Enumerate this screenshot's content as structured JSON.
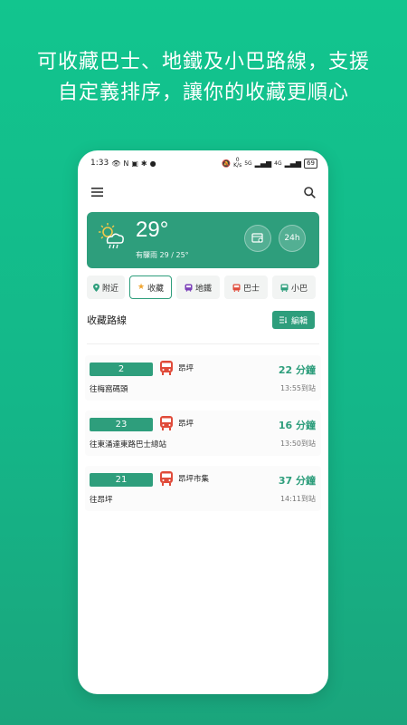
{
  "headline": {
    "line1": "可收藏巴士、地鐵及小巴路線，支援",
    "line2": "自定義排序，讓你的收藏更順心"
  },
  "status_bar": {
    "time": "1:33",
    "network_speed": "0\nK/s",
    "signal": "5G",
    "signal2": "4G",
    "battery": "69"
  },
  "weather": {
    "temperature": "29°",
    "description": "有驟雨 29 / 25°",
    "btn_24h": "24h"
  },
  "tabs": [
    {
      "label": "附近",
      "icon": "location-pin-icon"
    },
    {
      "label": "收藏",
      "icon": "star-icon"
    },
    {
      "label": "地鐵",
      "icon": "metro-icon"
    },
    {
      "label": "巴士",
      "icon": "bus-icon"
    },
    {
      "label": "小巴",
      "icon": "minibus-icon"
    }
  ],
  "favorites": {
    "title": "收藏路線",
    "edit_label": "編輯"
  },
  "routes": [
    {
      "number": "2",
      "stop": "昂坪",
      "destination": "往梅窩碼頭",
      "eta": "22 分鐘",
      "arrive": "13:55到站"
    },
    {
      "number": "23",
      "stop": "昂坪",
      "destination": "往東涌達東路巴士總站",
      "eta": "16 分鐘",
      "arrive": "13:50到站"
    },
    {
      "number": "21",
      "stop": "昂坪市集",
      "destination": "往昂坪",
      "eta": "37 分鐘",
      "arrive": "14:11到站"
    }
  ],
  "colors": {
    "accent": "#2e9e7c",
    "bus_red": "#e04b3a",
    "background": "#14b789"
  }
}
